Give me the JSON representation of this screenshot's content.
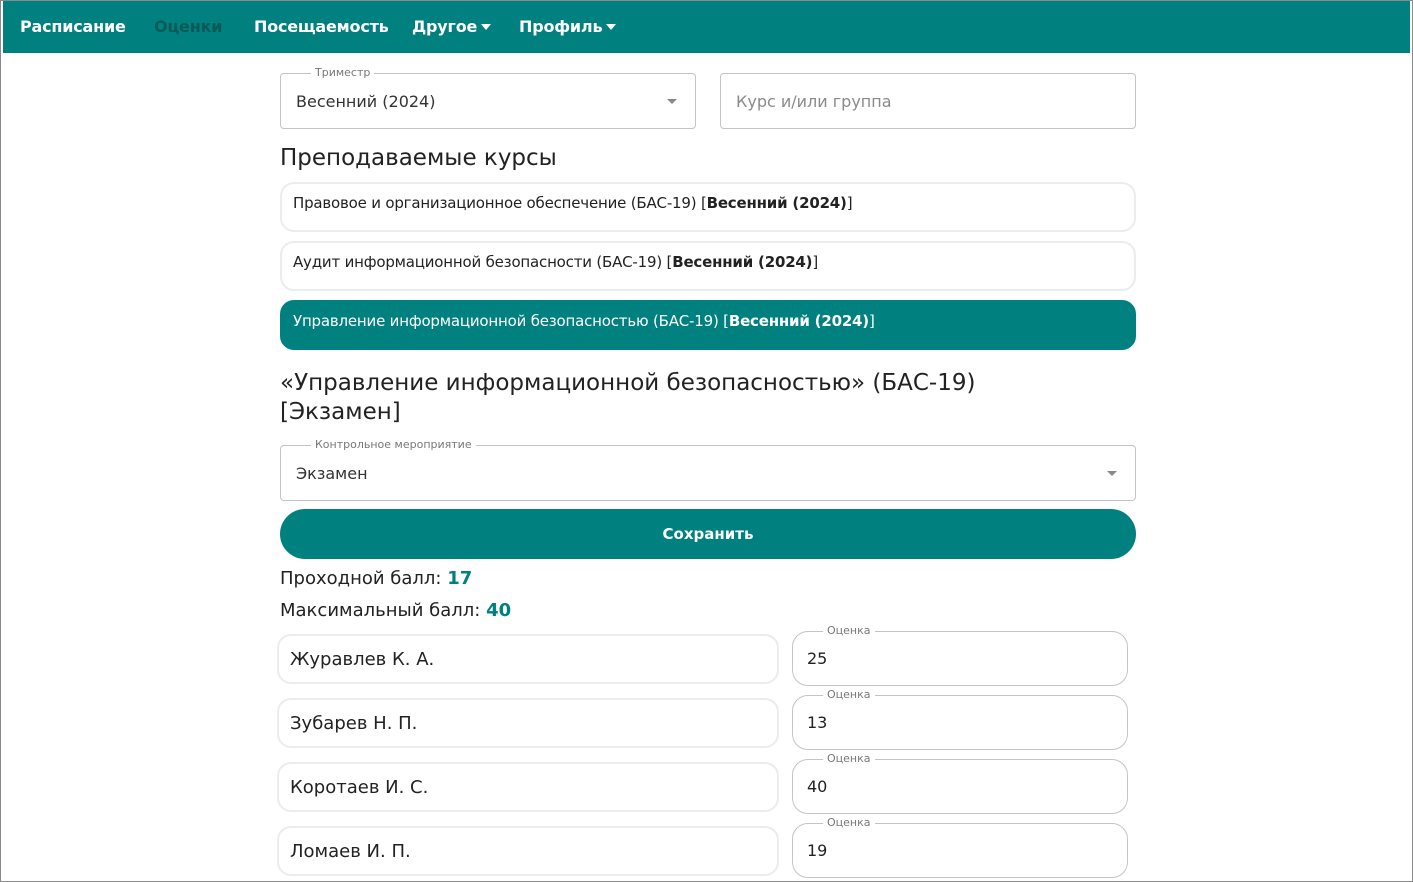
{
  "nav": {
    "items": [
      {
        "label": "Расписание"
      },
      {
        "label": "Оценки"
      },
      {
        "label": "Посещаемость"
      },
      {
        "label": "Другое"
      },
      {
        "label": "Профиль"
      }
    ],
    "active": "Оценки",
    "colors": {
      "bar": "#00807f",
      "active_text": "#0a5a57"
    }
  },
  "filters": {
    "trimester_label": "Триместр",
    "trimester_value": "Весенний (2024)",
    "group_placeholder": "Курс и/или группа"
  },
  "courses_title": "Преподаваемые курсы",
  "courses": [
    {
      "name": "Правовое и организационное обеспечение (БАС-19) [",
      "term": "Весенний (2024)",
      "close": "]",
      "selected": false
    },
    {
      "name": "Аудит информационной безопасности (БАС-19) [",
      "term": "Весенний (2024)",
      "close": "]",
      "selected": false
    },
    {
      "name": "Управление информационной безопасностью (БАС-19) [",
      "term": "Весенний (2024)",
      "close": "]",
      "selected": true
    }
  ],
  "detail": {
    "title_line1": "«Управление информационной безопасностью» (БАС-19)",
    "title_line2": "[Экзамен]",
    "event_label": "Контрольное мероприятие",
    "event_value": "Экзамен",
    "save_label": "Сохранить",
    "pass_label": "Проходной балл: ",
    "pass_value": "17",
    "max_label": "Максимальный балл: ",
    "max_value": "40"
  },
  "grade_label": "Оценка",
  "students": [
    {
      "name": "Журавлев К. А.",
      "grade": "25"
    },
    {
      "name": "Зубарев Н. П.",
      "grade": "13"
    },
    {
      "name": "Коротаев И. С.",
      "grade": "40"
    },
    {
      "name": "Ломаев И. П.",
      "grade": "19"
    }
  ]
}
